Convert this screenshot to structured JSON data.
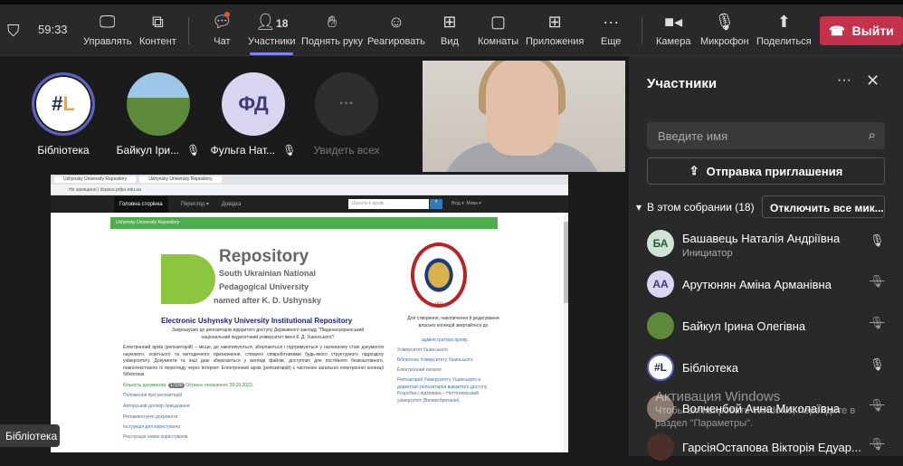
{
  "toolbar": {
    "timer": "59:33",
    "participant_count": "18",
    "items": [
      {
        "label": "Управлять",
        "icon": "manage-icon"
      },
      {
        "label": "Контент",
        "icon": "content-icon"
      },
      {
        "label": "Чат",
        "icon": "chat-icon"
      },
      {
        "label": "Участники",
        "icon": "people-icon"
      },
      {
        "label": "Поднять руку",
        "icon": "raise-hand-icon"
      },
      {
        "label": "Реагировать",
        "icon": "react-icon"
      },
      {
        "label": "Вид",
        "icon": "view-icon"
      },
      {
        "label": "Комнаты",
        "icon": "rooms-icon"
      },
      {
        "label": "Приложения",
        "icon": "apps-icon"
      },
      {
        "label": "Еще",
        "icon": "more-icon"
      },
      {
        "label": "Камера",
        "icon": "camera-icon"
      },
      {
        "label": "Микрофон",
        "icon": "mic-icon"
      },
      {
        "label": "Поделиться",
        "icon": "share-icon"
      }
    ],
    "leave": "Выйти",
    "chat_badge_color": "#e0582c",
    "accent": "#7f85f5",
    "leave_color": "#c4314b"
  },
  "stage": {
    "tiles": [
      {
        "name": "Бібліотека"
      },
      {
        "name": "Байкул Іри..."
      },
      {
        "name": "Фульга Нат...",
        "initials": "ФД"
      },
      {
        "name": "Увидеть всех"
      }
    ],
    "presenter_label": "Бібліотека"
  },
  "shared": {
    "tabs": [
      "Ushynsky University Repository",
      "Ushynsky University Repository"
    ],
    "url": "Не захищено | dspace.pdpu.edu.ua",
    "nav": {
      "home": "Головна сторінка",
      "browse": "Перегляд ▾",
      "help": "Довідка",
      "search_placeholder": "Шукати в архіві",
      "login": "Вхід ▾",
      "lang": "Мова ▾"
    },
    "banner": "Ushynsky University Repository",
    "logo_title": "Repository",
    "logo_lines": [
      "South Ukrainian National",
      "Pedagogical University",
      "named after K. D. Ushynsky"
    ],
    "seal_year": "1817",
    "title": "Electronic Ushynsky University Institutional Repository",
    "welcome": "Запрошуємо до репозитарію відкритого доступу Державного закладу \"Південноукраїнський національний педагогічний університет імені К. Д. Ушинського\"!",
    "description": "Електронний архів (репозитарій) – місце, де накопичуються, зберігаються і підтримуються у належному стані документи наукового, освітнього та методичного призначення, створені співробітниками будь-якого структурного підрозділу університету. Документи та інші дані зберігаються у вигляді файлів, доступних для постійного безкоштовного, повнотекстового їх перегляду через Інтернет. Електронний архів (репозитарій) є частиною загальної електронної колекції бібліотеки.",
    "count_label": "Кількість документів:",
    "count": "17156",
    "updated": "Останнє оновлення: 28.09.2023.",
    "links": [
      "Положення про репозитарій",
      "Авторський договір приєднання",
      "Регламентуючі документи",
      "Інструкція для користувача",
      "Реєстрація нових користувачів"
    ],
    "side_text": "Для створення, накопичення й редагування власних колекцій звертайтеся до",
    "side_admin": "адміністратора архіву.",
    "side_links": [
      "Університет Ушинського",
      "Бібліотека Університету Ушинського",
      "Електронний каталог",
      "Репозитарій Університету Ушинського в директорії репозитаріїв відкритого доступу. Розробка і підтримка – Ноттінгемський університет (Великобританія)."
    ]
  },
  "panel": {
    "title": "Участники",
    "search_placeholder": "Введите имя",
    "invite": "Отправка приглашения",
    "section": "В этом собрании (18)",
    "mute_all": "Отключить все мик...",
    "participants": [
      {
        "initials": "БА",
        "name": "Башавець Наталія Андріївна",
        "role": "Инициатор",
        "mic": "on",
        "color": "#cfe3d6",
        "text": "#2d5a3d"
      },
      {
        "initials": "АА",
        "name": "Арутюнян Аміна Арманівна",
        "mic": "off",
        "color": "#d8d6f0",
        "text": "#3b3a7a"
      },
      {
        "initials": "",
        "name": "Байкул Ірина Олегівна",
        "mic": "off",
        "color": "#5c8a3a",
        "text": "#fff"
      },
      {
        "initials": "#L",
        "name": "Бібліотека",
        "mic": "on",
        "color": "#fff",
        "text": "#1b2a5a"
      },
      {
        "initials": "",
        "name": "Волченбой Анна Миколаївна",
        "mic": "off",
        "color": "#8a7a70",
        "text": "#fff"
      },
      {
        "initials": "",
        "name": "ГарсіяОстапова Вікторія Едуар...",
        "mic": "off",
        "color": "#4a3028",
        "text": "#fff"
      }
    ]
  },
  "watermark": {
    "title": "Активация Windows",
    "text": "Чтобы активировать Windows, перейдите в раздел \"Параметры\"."
  }
}
